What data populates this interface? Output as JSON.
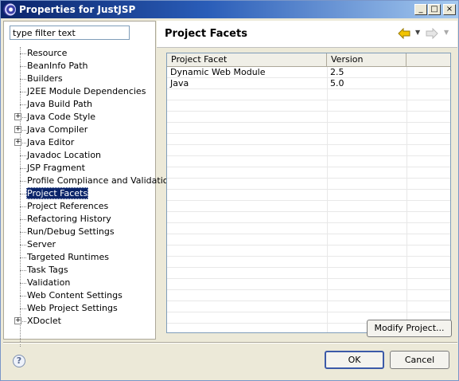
{
  "window": {
    "title": "Properties for JustJSP"
  },
  "titlebar_buttons": {
    "minimize": "_",
    "maximize": "□",
    "close": "×"
  },
  "filter": {
    "placeholder": "type filter text"
  },
  "tree": {
    "items": [
      {
        "label": "Resource",
        "expandable": false
      },
      {
        "label": "BeanInfo Path",
        "expandable": false
      },
      {
        "label": "Builders",
        "expandable": false
      },
      {
        "label": "J2EE Module Dependencies",
        "expandable": false
      },
      {
        "label": "Java Build Path",
        "expandable": false
      },
      {
        "label": "Java Code Style",
        "expandable": true
      },
      {
        "label": "Java Compiler",
        "expandable": true
      },
      {
        "label": "Java Editor",
        "expandable": true
      },
      {
        "label": "Javadoc Location",
        "expandable": false
      },
      {
        "label": "JSP Fragment",
        "expandable": false
      },
      {
        "label": "Profile Compliance and Validation",
        "expandable": false
      },
      {
        "label": "Project Facets",
        "expandable": false,
        "selected": true
      },
      {
        "label": "Project References",
        "expandable": false
      },
      {
        "label": "Refactoring History",
        "expandable": false
      },
      {
        "label": "Run/Debug Settings",
        "expandable": false
      },
      {
        "label": "Server",
        "expandable": false
      },
      {
        "label": "Targeted Runtimes",
        "expandable": false
      },
      {
        "label": "Task Tags",
        "expandable": false
      },
      {
        "label": "Validation",
        "expandable": false
      },
      {
        "label": "Web Content Settings",
        "expandable": false
      },
      {
        "label": "Web Project Settings",
        "expandable": false
      },
      {
        "label": "XDoclet",
        "expandable": true
      }
    ]
  },
  "page": {
    "title": "Project Facets"
  },
  "facets_table": {
    "columns": [
      "Project Facet",
      "Version"
    ],
    "rows": [
      [
        "Dynamic Web Module",
        "2.5"
      ],
      [
        "Java",
        "5.0"
      ]
    ]
  },
  "buttons": {
    "modify": "Modify Project...",
    "ok": "OK",
    "cancel": "Cancel",
    "help": "?"
  },
  "colors": {
    "selection": "#0a246a",
    "titlebar_start": "#0a246a",
    "titlebar_end": "#a6caf0",
    "back_arrow": "#d9a800"
  }
}
